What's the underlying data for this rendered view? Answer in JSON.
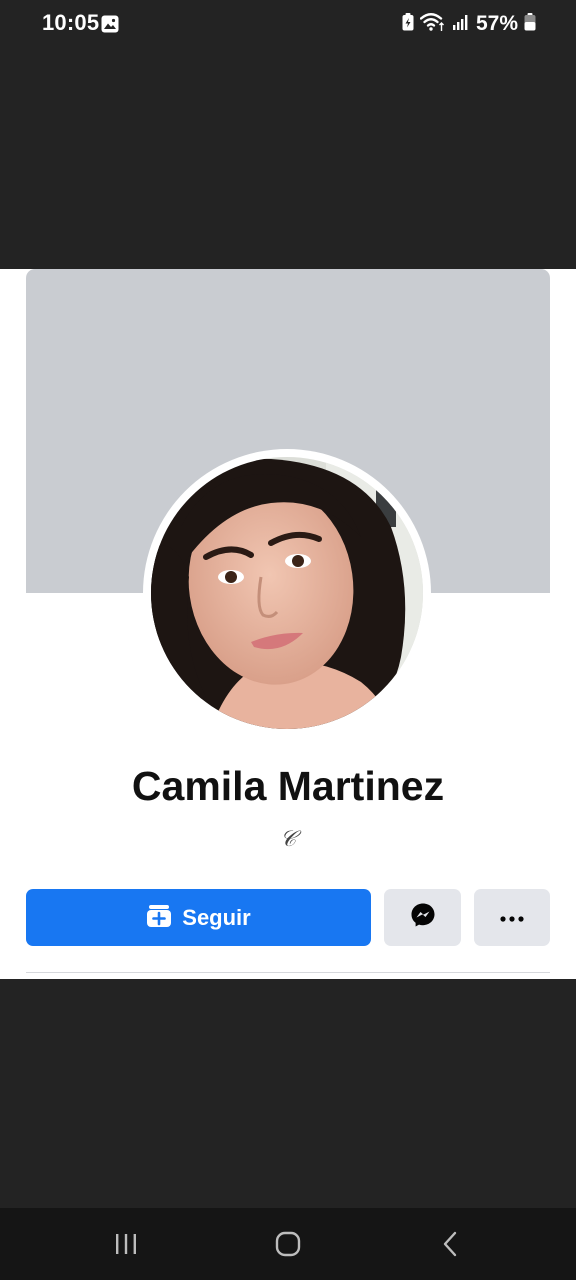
{
  "status_bar": {
    "time": "10:05",
    "battery_percent": "57%",
    "icons": [
      "image-icon",
      "battery-saver-icon",
      "wifi-icon",
      "signal-icon",
      "battery-icon"
    ]
  },
  "profile": {
    "name": "Camila Martinez",
    "bio": "𝒞",
    "cover_color": "#c9ccd1"
  },
  "actions": {
    "follow_label": "Seguir",
    "follow_icon": "follow-add-icon",
    "messenger_icon": "messenger-icon",
    "more_icon": "more-icon",
    "accent": "#1877f2"
  },
  "nav": {
    "icons": [
      "recent-apps-icon",
      "home-icon",
      "back-icon"
    ]
  }
}
